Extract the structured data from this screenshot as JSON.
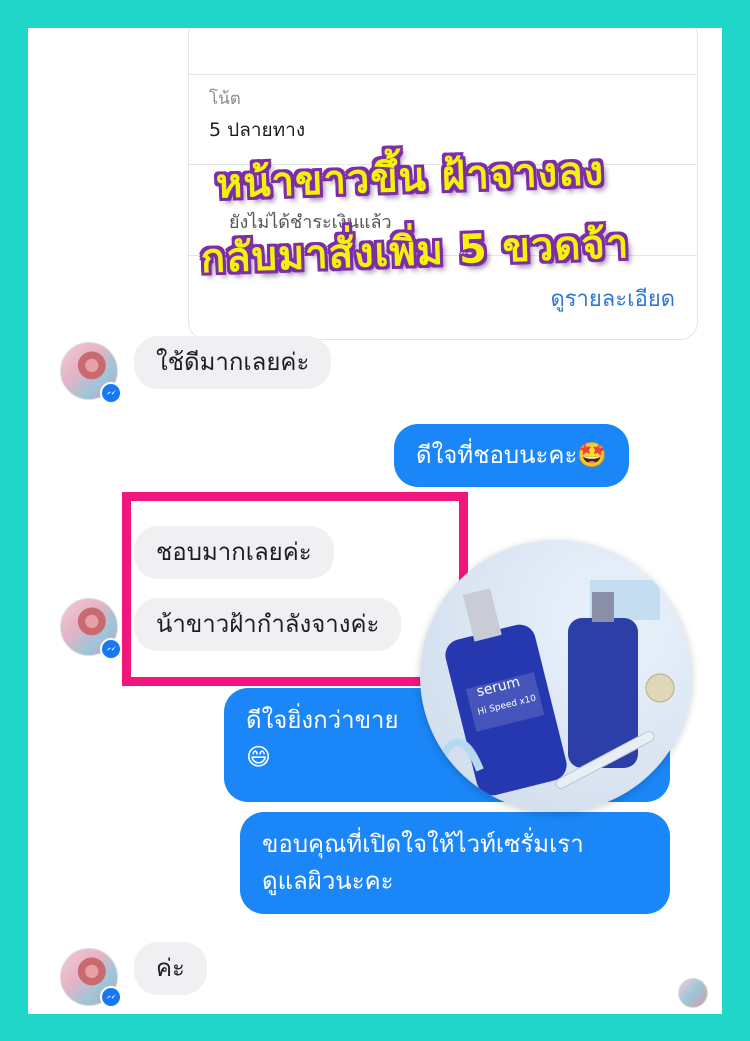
{
  "order": {
    "note_label": "โน้ต",
    "note_value": "5 ปลายทาง",
    "status_text": "ยังไม่ได้ชำระเงินแล้ว",
    "details_link": "ดูรายละเอียด"
  },
  "headline": {
    "line1": "หน้าขาวขึ้น ฝ้าจางลง",
    "line2": "กลับมาสั่งเพิ่ม 5 ขวดจ้า"
  },
  "messages": [
    {
      "side": "in",
      "text": "ใช้ดีมากเลยค่ะ"
    },
    {
      "side": "out",
      "text": "ดีใจที่ชอบนะคะ",
      "emoji": "🤩"
    },
    {
      "side": "in",
      "text": "ชอบมากเลยค่ะ"
    },
    {
      "side": "in",
      "text": "น้าขาวฝ้ากำลังจางค่ะ"
    },
    {
      "side": "out",
      "text": "ดีใจยิ่งกว่าขาย",
      "emoji": "😄"
    },
    {
      "side": "out",
      "text_line1": "ขอบคุณที่เปิดใจให้ไวท์เซรั่มเรา",
      "text_line2": "ดูแลผิวนะคะ"
    },
    {
      "side": "in",
      "text": "ค่ะ"
    }
  ],
  "product": {
    "label_line1": "serum",
    "label_line2": "Hi Speed x10",
    "icon": "serum-bottle-photo"
  },
  "colors": {
    "frame": "#1fd6c8",
    "outgoing_bubble": "#1a86f7",
    "incoming_bubble": "#f0f0f2",
    "highlight": "#f2157d",
    "headline_fill": "#f5f20a",
    "headline_stroke": "#7b2ea8"
  }
}
